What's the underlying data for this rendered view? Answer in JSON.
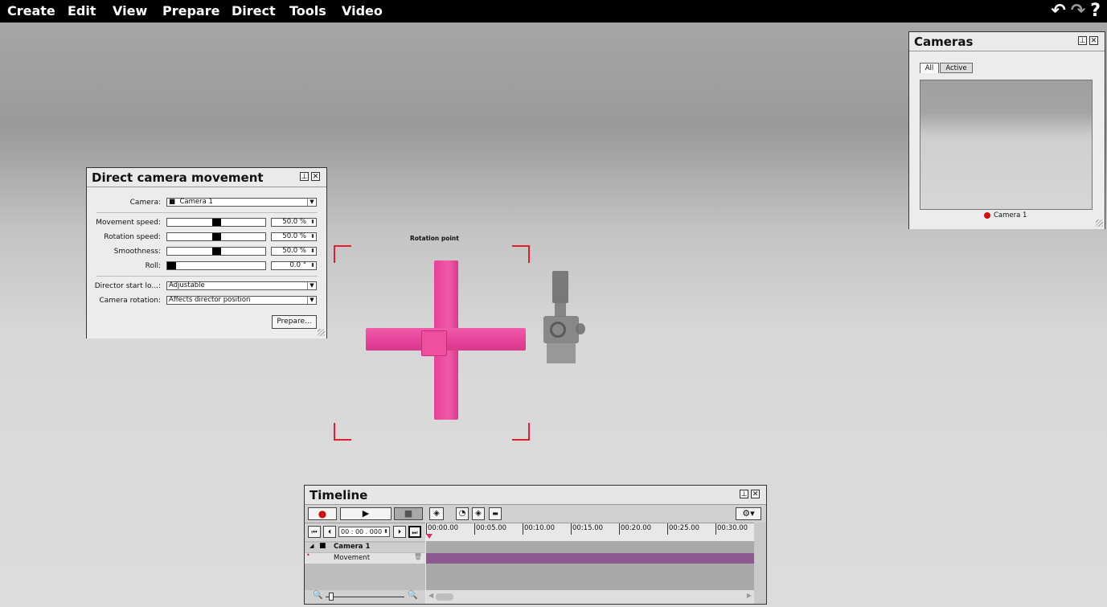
{
  "menu": {
    "items": [
      "Create",
      "Edit",
      "View",
      "Prepare",
      "Direct",
      "Tools",
      "Video"
    ],
    "icons": [
      "undo-icon",
      "redo-icon",
      "help-icon"
    ]
  },
  "direct_panel": {
    "title": "Direct camera movement",
    "camera_label": "Camera:",
    "camera_value": "Camera 1",
    "movement_speed_label": "Movement speed:",
    "movement_speed_value": "50.0 %",
    "movement_speed_level": 0.5,
    "rotation_speed_label": "Rotation speed:",
    "rotation_speed_value": "50.0 %",
    "rotation_speed_level": 0.5,
    "smoothness_label": "Smoothness:",
    "smoothness_value": "50.0 %",
    "smoothness_level": 0.5,
    "roll_label": "Roll:",
    "roll_value": "0.0 °",
    "roll_level": 0.0,
    "director_start_label": "Director start lo...:",
    "director_start_value": "Adjustable",
    "camera_rotation_label": "Camera rotation:",
    "camera_rotation_value": "Affects director position",
    "prepare_button": "Prepare..."
  },
  "cameras_panel": {
    "title": "Cameras",
    "tabs": [
      "All",
      "Active"
    ],
    "camera_name": "Camera 1",
    "status_color": "#d01010"
  },
  "viewport": {
    "rotation_point_label": "Rotation point",
    "object_color": "#ee4a9c",
    "selection_color": "#e0202a"
  },
  "timeline": {
    "title": "Timeline",
    "time_value": "00 : 00 . 000",
    "ruler": [
      "00:00.00",
      "00:05.00",
      "00:10.00",
      "00:15.00",
      "00:20.00",
      "00:25.00",
      "00:30.00"
    ],
    "track_name": "Camera 1",
    "subtrack_name": "Movement",
    "track_color": "#8b5a8e"
  }
}
